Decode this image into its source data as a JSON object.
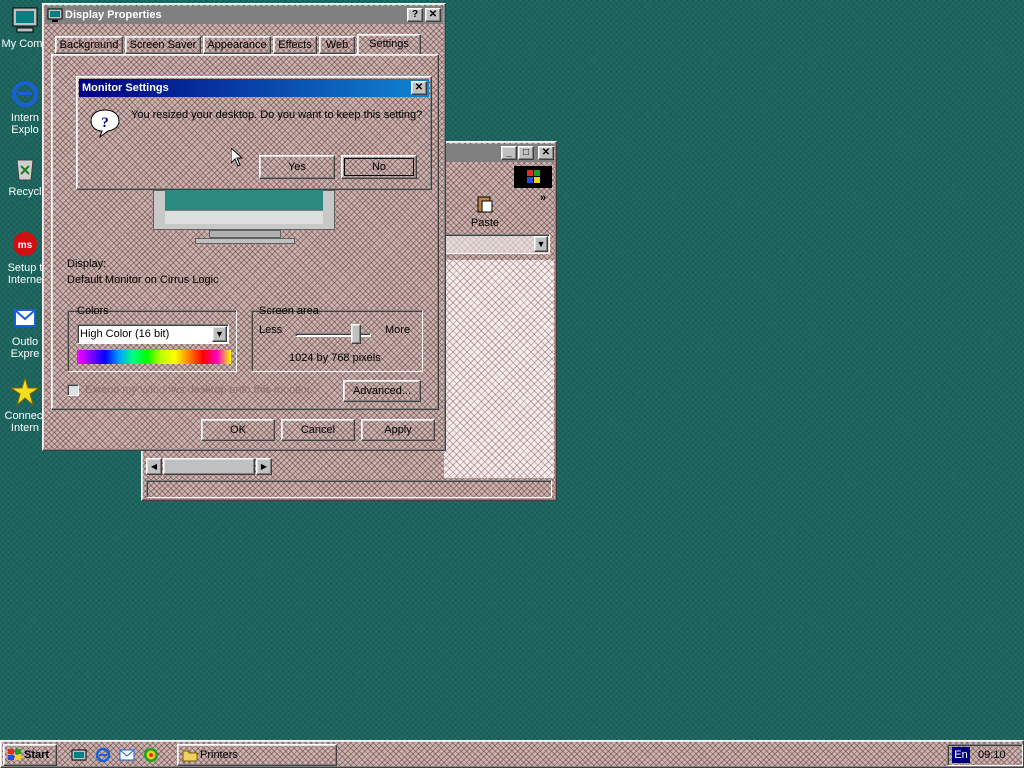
{
  "desktop": {
    "icons": [
      {
        "label": "My Comp"
      },
      {
        "label": "Intern Explo"
      },
      {
        "label": "Recycl"
      },
      {
        "label": "Setup t Interne"
      },
      {
        "label": "Outlo Expre"
      },
      {
        "label": "Connect Intern"
      }
    ]
  },
  "display_properties": {
    "title": "Display Properties",
    "tabs": [
      "Background",
      "Screen Saver",
      "Appearance",
      "Effects",
      "Web",
      "Settings"
    ],
    "display_label": "Display:",
    "display_value": "Default Monitor on Cirrus Logic",
    "colors_label": "Colors",
    "colors_selected": "High Color (16 bit)",
    "screen_area_label": "Screen area",
    "less_label": "Less",
    "more_label": "More",
    "resolution": "1024 by 768 pixels",
    "slider_level": 0.85,
    "extend_checkbox_label": "Extend my Windows desktop onto this monitor.",
    "advanced_label": "Advanced...",
    "ok_label": "OK",
    "cancel_label": "Cancel",
    "apply_label": "Apply"
  },
  "monitor_settings": {
    "title": "Monitor Settings",
    "message": "You resized your desktop.  Do you want to keep this setting?",
    "yes_label": "Yes",
    "no_label": "No"
  },
  "printers_window": {
    "paste_label": "Paste"
  },
  "taskbar": {
    "start_label": "Start",
    "tasks": [
      "Printers"
    ],
    "language": "En",
    "clock": "09:10"
  },
  "colors": {
    "desktop": "#1f6a62",
    "titlebar_active": "#000080",
    "face": "#c0c0c0"
  }
}
